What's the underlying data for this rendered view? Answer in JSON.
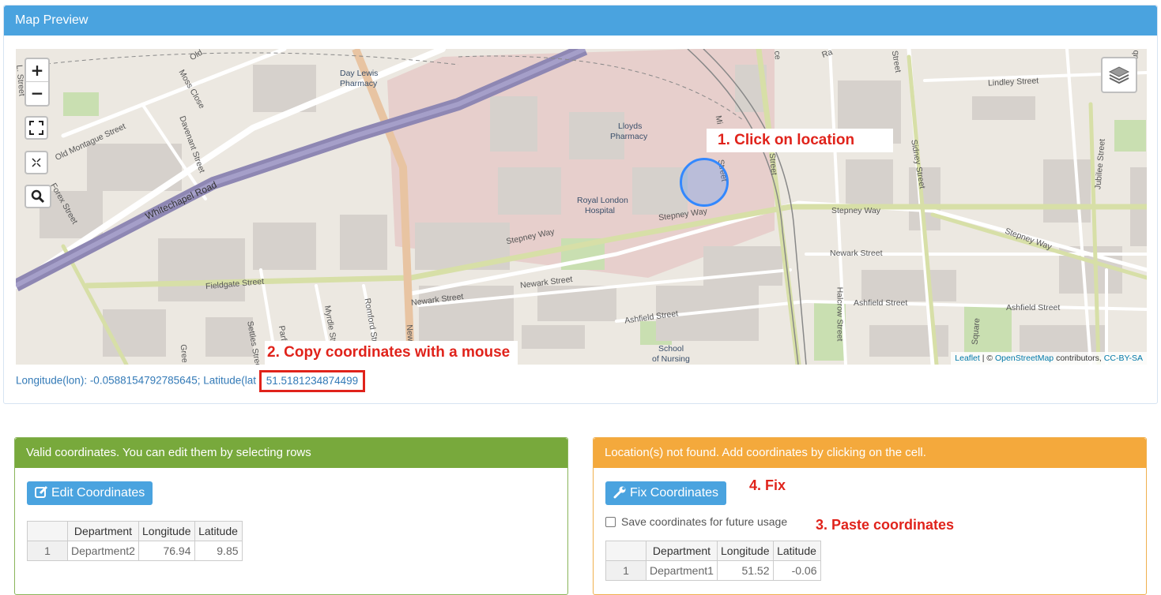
{
  "map_panel": {
    "title": "Map Preview",
    "zoom_in": "+",
    "zoom_out": "−",
    "annotation_click": "1. Click on location",
    "annotation_copy": "2. Copy coordinates with a mouse",
    "attribution": {
      "leaflet": "Leaflet",
      "sep": " | © ",
      "osm": "OpenStreetMap",
      "contrib": " contributors, ",
      "license": "CC-BY-SA"
    },
    "coords": {
      "prefix": "Longitude(lon): -0.0588154792785645; Latitude(lat",
      "lat_value": "51.5181234874499"
    },
    "map_labels": {
      "old_montague": "Old Montague Street",
      "davenant": "Davenant Street",
      "moss_close": "Moss Close",
      "whitechapel": "Whitechapel Road",
      "day_lewis": "Day Lewis",
      "pharmacy1": "Pharmacy",
      "lloyds": "Lloyds",
      "pharmacy2": "Pharmacy",
      "royal_london": "Royal London",
      "hospital": "Hospital",
      "stepney1": "Stepney Way",
      "stepney2": "Stepney Way",
      "stepney3": "Stepney Way",
      "stepney4": "Stepney Way",
      "fieldgate": "Fieldgate Street",
      "newark1": "Newark Street",
      "newark2": "Newark Street",
      "newark3": "Newark Street",
      "ashfield1": "Ashfield Street",
      "ashfield2": "Ashfield Street",
      "ashfield3": "Ashfield Street",
      "lindley": "Lindley Street",
      "sidney": "Sidney Street",
      "jubilee": "Jubilee Street",
      "halcrow": "Halcrow Street",
      "romford": "Romford Street",
      "myrdle": "Myrdle Street",
      "parfett": "Parfett",
      "settles": "Settles Street",
      "school": "School",
      "nursing": "of Nursing",
      "forex": "Forex Street",
      "old": "Old",
      "greenfield": "Gree",
      "square": "Square",
      "new": "New",
      "street_l": "L. Street",
      "mile": "Mi",
      "street_m": "Street",
      "street_r": "Street",
      "ce": "ce",
      "ra": "Ra",
      "jub": "Jub",
      "street_t": "Street"
    }
  },
  "valid_panel": {
    "title": "Valid coordinates. You can edit them by selecting rows",
    "button": "Edit Coordinates",
    "columns": [
      "Department",
      "Longitude",
      "Latitude"
    ],
    "rows": [
      {
        "idx": "1",
        "department": "Department2",
        "longitude": "76.94",
        "latitude": "9.85"
      }
    ]
  },
  "missing_panel": {
    "title": "Location(s) not found. Add coordinates by clicking on the cell.",
    "button": "Fix Coordinates",
    "checkbox_label": "Save coordinates for future usage",
    "annotation_fix": "4. Fix",
    "annotation_paste": "3. Paste coordinates",
    "columns": [
      "Department",
      "Longitude",
      "Latitude"
    ],
    "rows": [
      {
        "idx": "1",
        "department": "Department1",
        "longitude": "51.52",
        "latitude": "-0.06"
      }
    ]
  },
  "colors": {
    "primary": "#4aa3df",
    "success": "#78a93c",
    "warning": "#f4a93c",
    "annotation": "#e0231b",
    "marker": "#3388ff"
  }
}
